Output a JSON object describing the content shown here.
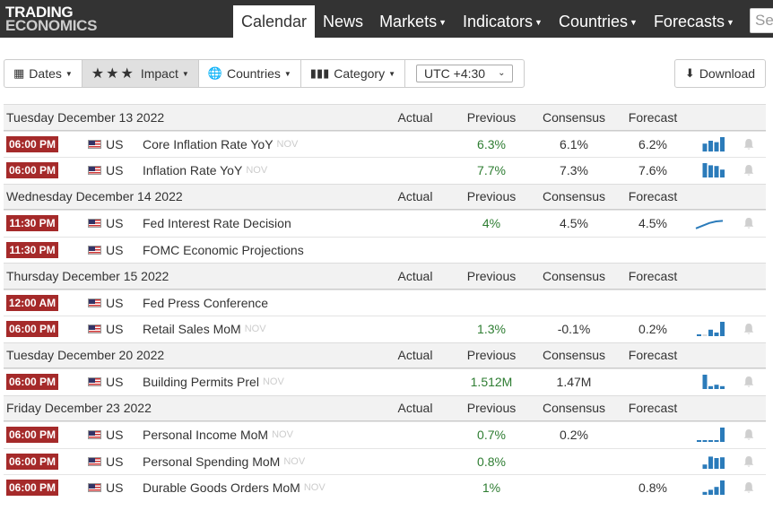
{
  "logo": {
    "line1": "TRADING",
    "line2": "ECONOMICS"
  },
  "nav": [
    {
      "label": "Calendar",
      "active": true,
      "dropdown": false
    },
    {
      "label": "News",
      "active": false,
      "dropdown": false
    },
    {
      "label": "Markets",
      "active": false,
      "dropdown": true
    },
    {
      "label": "Indicators",
      "active": false,
      "dropdown": true
    },
    {
      "label": "Countries",
      "active": false,
      "dropdown": true
    },
    {
      "label": "Forecasts",
      "active": false,
      "dropdown": true
    }
  ],
  "search": {
    "placeholder": "Se"
  },
  "toolbar": {
    "dates": "Dates",
    "impact_stars": "★★★",
    "impact": "Impact",
    "countries": "Countries",
    "category": "Category",
    "timezone": "UTC +4:30",
    "download": "Download"
  },
  "columns": {
    "actual": "Actual",
    "previous": "Previous",
    "consensus": "Consensus",
    "forecast": "Forecast"
  },
  "colors": {
    "accent_red": "#a52a2a",
    "previous_green": "#2e7d32",
    "spark_blue": "#2b7bba",
    "nav_bg": "#333333"
  },
  "groups": [
    {
      "date": "Tuesday December 13 2022",
      "events": [
        {
          "time": "06:00 PM",
          "country": "US",
          "event": "Core Inflation Rate YoY",
          "ref": "NOV",
          "actual": "",
          "previous": "6.3%",
          "consensus": "6.1%",
          "forecast": "6.2%",
          "spark": [
            0.55,
            0.75,
            0.65,
            1.0
          ],
          "spark_type": "bar"
        },
        {
          "time": "06:00 PM",
          "country": "US",
          "event": "Inflation Rate YoY",
          "ref": "NOV",
          "actual": "",
          "previous": "7.7%",
          "consensus": "7.3%",
          "forecast": "7.6%",
          "spark": [
            1.0,
            0.85,
            0.8,
            0.55
          ],
          "spark_type": "bar"
        }
      ]
    },
    {
      "date": "Wednesday December 14 2022",
      "events": [
        {
          "time": "11:30 PM",
          "country": "US",
          "event": "Fed Interest Rate Decision",
          "ref": "",
          "actual": "",
          "previous": "4%",
          "consensus": "4.5%",
          "forecast": "4.5%",
          "spark": [
            0.1,
            0.35,
            0.6,
            0.75,
            0.8
          ],
          "spark_type": "line"
        },
        {
          "time": "11:30 PM",
          "country": "US",
          "event": "FOMC Economic Projections",
          "ref": "",
          "actual": "",
          "previous": "",
          "consensus": "",
          "forecast": "",
          "spark": [],
          "spark_type": "none"
        }
      ]
    },
    {
      "date": "Thursday December 15 2022",
      "events": [
        {
          "time": "12:00 AM",
          "country": "US",
          "event": "Fed Press Conference",
          "ref": "",
          "actual": "",
          "previous": "",
          "consensus": "",
          "forecast": "",
          "spark": [],
          "spark_type": "none"
        },
        {
          "time": "06:00 PM",
          "country": "US",
          "event": "Retail Sales MoM",
          "ref": "NOV",
          "actual": "",
          "previous": "1.3%",
          "consensus": "-0.1%",
          "forecast": "0.2%",
          "spark": [
            0.1,
            0.0,
            0.45,
            0.25,
            1.0
          ],
          "spark_type": "bar"
        }
      ]
    },
    {
      "date": "Tuesday December 20 2022",
      "events": [
        {
          "time": "06:00 PM",
          "country": "US",
          "event": "Building Permits Prel",
          "ref": "NOV",
          "actual": "",
          "previous": "1.512M",
          "consensus": "1.47M",
          "forecast": "",
          "spark": [
            1.0,
            0.2,
            0.3,
            0.2
          ],
          "spark_type": "bar"
        }
      ]
    },
    {
      "date": "Friday December 23 2022",
      "events": [
        {
          "time": "06:00 PM",
          "country": "US",
          "event": "Personal Income MoM",
          "ref": "NOV",
          "actual": "",
          "previous": "0.7%",
          "consensus": "0.2%",
          "forecast": "",
          "spark": [
            0.12,
            0.12,
            0.12,
            0.12,
            1.0
          ],
          "spark_type": "bar"
        },
        {
          "time": "06:00 PM",
          "country": "US",
          "event": "Personal Spending MoM",
          "ref": "NOV",
          "actual": "",
          "previous": "0.8%",
          "consensus": "",
          "forecast": "",
          "spark": [
            0.3,
            0.85,
            0.75,
            0.8
          ],
          "spark_type": "bar"
        },
        {
          "time": "06:00 PM",
          "country": "US",
          "event": "Durable Goods Orders MoM",
          "ref": "NOV",
          "actual": "",
          "previous": "1%",
          "consensus": "",
          "forecast": "0.8%",
          "spark": [
            0.2,
            0.35,
            0.55,
            1.0
          ],
          "spark_type": "bar"
        }
      ]
    }
  ]
}
